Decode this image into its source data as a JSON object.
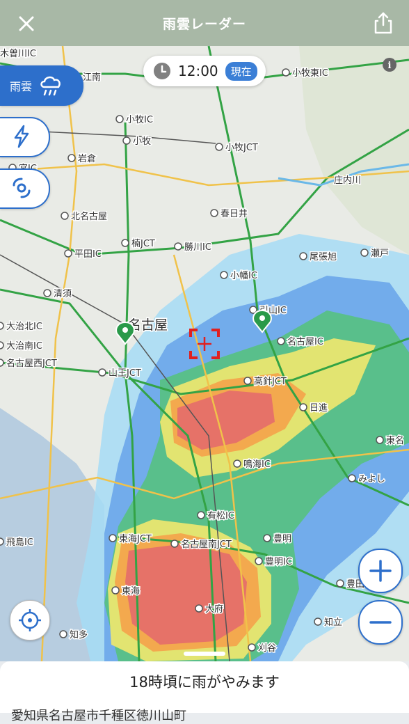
{
  "header": {
    "title": "雨雲レーダー"
  },
  "time": {
    "value": "12:00",
    "badge": "現在"
  },
  "layers": [
    {
      "label": "雨雲",
      "icon": "rain-cloud-icon"
    },
    {
      "label": "",
      "icon": "lightning-icon"
    },
    {
      "label": "",
      "icon": "typhoon-icon"
    }
  ],
  "forecast": {
    "message": "18時頃に雨がやみます",
    "address": "愛知県名古屋市千種区徳川山町"
  },
  "map": {
    "places": [
      {
        "name": "木曽川IC"
      },
      {
        "name": "江南"
      },
      {
        "name": "小牧IC"
      },
      {
        "name": "小牧"
      },
      {
        "name": "岩倉"
      },
      {
        "name": "小牧JCT"
      },
      {
        "name": "小牧東IC"
      },
      {
        "name": "庄内川"
      },
      {
        "name": "宮IC"
      },
      {
        "name": "春日井"
      },
      {
        "name": "北名古屋"
      },
      {
        "name": "楠JCT"
      },
      {
        "name": "平田IC"
      },
      {
        "name": "勝川IC"
      },
      {
        "name": "瀬戸"
      },
      {
        "name": "尾張旭"
      },
      {
        "name": "清須"
      },
      {
        "name": "小幡IC"
      },
      {
        "name": "引山IC"
      },
      {
        "name": "大治北IC"
      },
      {
        "name": "名古屋"
      },
      {
        "name": "名古屋IC"
      },
      {
        "name": "大治南IC"
      },
      {
        "name": "名古屋西JCT"
      },
      {
        "name": "山王JCT"
      },
      {
        "name": "高針JCT"
      },
      {
        "name": "日進"
      },
      {
        "name": "東名"
      },
      {
        "name": "鳴海IC"
      },
      {
        "name": "みよし"
      },
      {
        "name": "有松IC"
      },
      {
        "name": "飛島IC"
      },
      {
        "name": "東海JCT"
      },
      {
        "name": "名古屋南JCT"
      },
      {
        "name": "豊明"
      },
      {
        "name": "豊明IC"
      },
      {
        "name": "豊田"
      },
      {
        "name": "東海"
      },
      {
        "name": "大府"
      },
      {
        "name": "知立"
      },
      {
        "name": "知多"
      },
      {
        "name": "刈谷"
      }
    ],
    "colors": {
      "light": "#a6dcf5",
      "blue": "#5d9be8",
      "green": "#55c27a",
      "yellow": "#f1e86e",
      "orange": "#f5a24a",
      "red": "#e46b6b",
      "road_main": "#33a345",
      "road_sub": "#f0c24a",
      "header": "#a8b8a6",
      "accent": "#2d6fcb"
    }
  }
}
